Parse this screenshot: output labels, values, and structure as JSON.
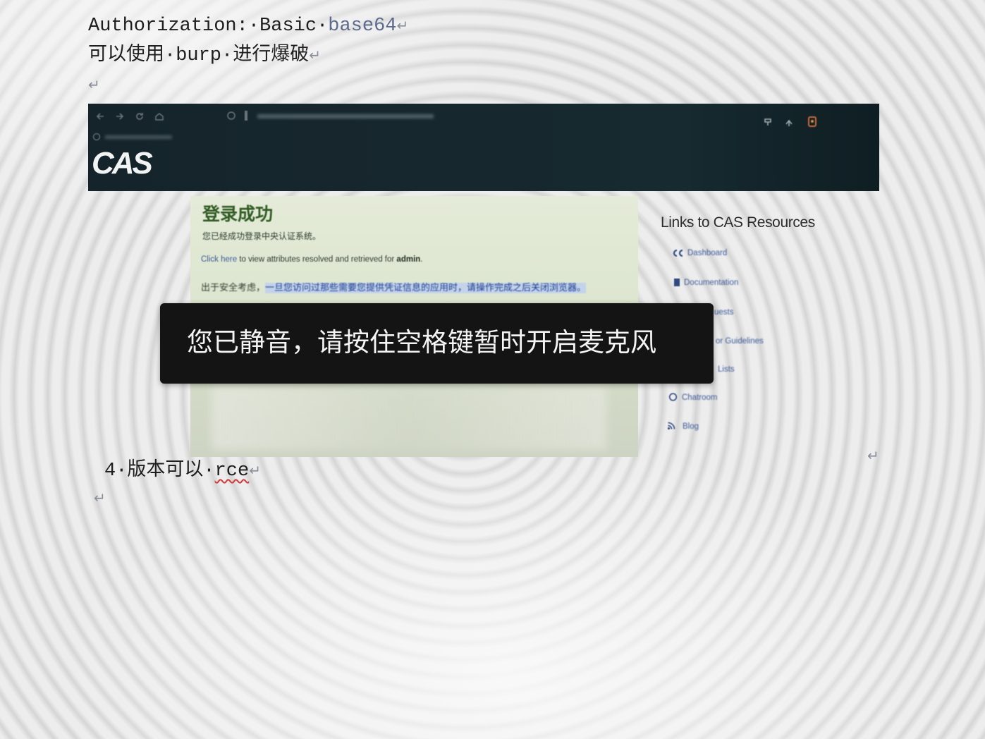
{
  "doc": {
    "line1": {
      "text": "Authorization:·Basic·",
      "highlight": "base64"
    },
    "line2": "可以使用·burp·进行爆破",
    "line4": {
      "text": "4·版本可以·",
      "misspelled": "rce"
    },
    "paragraph_mark": "↵"
  },
  "embedded_screenshot": {
    "browser_toolbar": {
      "icons": [
        "back-icon",
        "forward-icon",
        "reload-icon",
        "home-icon",
        "shield-icon",
        "info-icon",
        "globe-icon",
        "pin-icon",
        "share-icon",
        "extension-icon"
      ]
    },
    "logo": "CAS",
    "main": {
      "title": "登录成功",
      "message": "您已经成功登录中央认证系统。",
      "attributes_line": {
        "link": "Click here",
        "middle": " to view attributes resolved and retrieved for ",
        "user": "admin",
        "end": "."
      },
      "security_note": {
        "prefix": "出于安全考虑，",
        "highlighted": "一旦您访问过那些需要您提供凭证信息的应用时，请操作完成之后关闭浏览器。"
      }
    },
    "sidebar": {
      "title": "Links to CAS Resources",
      "links": [
        {
          "label": "Dashboard",
          "icon": "cas-icon"
        },
        {
          "label": "Documentation",
          "icon": "book-icon"
        },
        {
          "label": "uests"
        },
        {
          "label": "or Guidelines"
        },
        {
          "label": "Lists"
        },
        {
          "label": "Chatroom",
          "icon": "chat-icon"
        },
        {
          "label": "Blog",
          "icon": "rss-icon"
        }
      ]
    }
  },
  "toast": {
    "message": "您已静音，请按住空格键暂时开启麦克风"
  },
  "colors": {
    "header_bg": "#16272d",
    "panel_bg": "#dfe7d3",
    "title_green": "#2f5a22",
    "link_blue": "#3b5998",
    "toast_bg": "#141414",
    "spellcheck_red": "#d23a3a"
  }
}
